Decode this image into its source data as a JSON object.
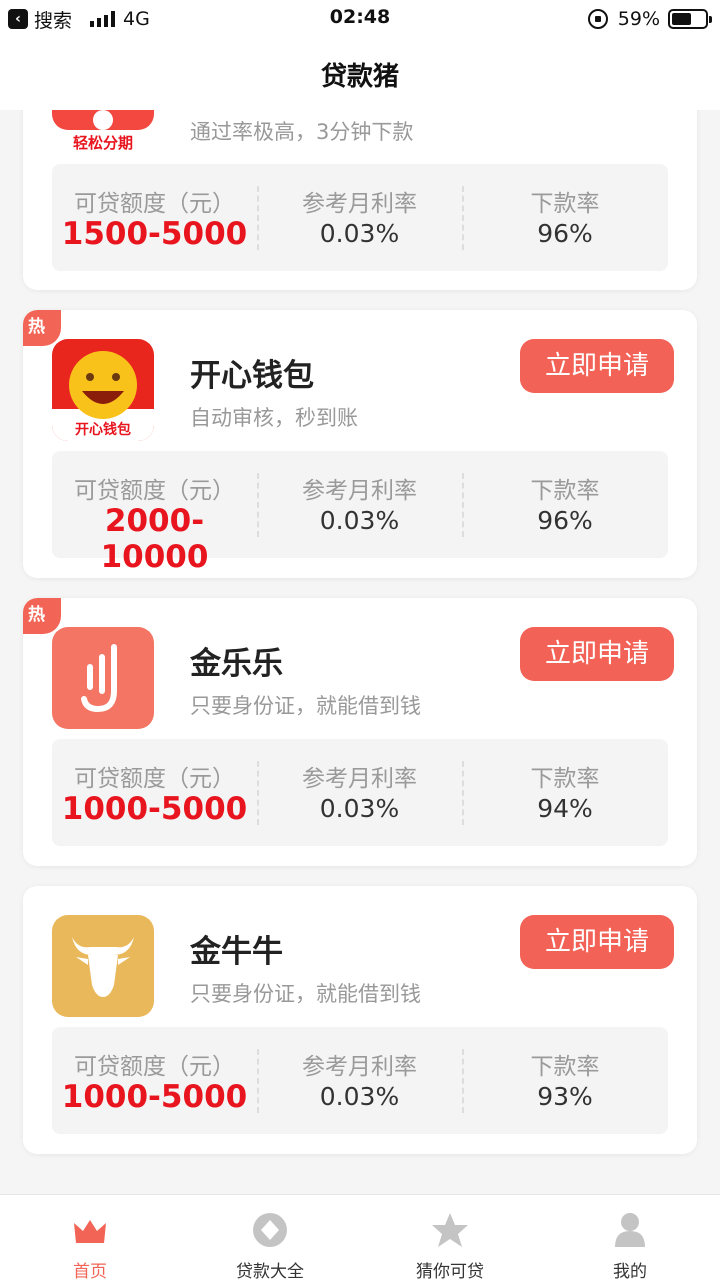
{
  "status_bar": {
    "back_app": "搜索",
    "network": "4G",
    "time": "02:48",
    "battery": "59%",
    "battery_level": 0.59
  },
  "nav": {
    "title": "贷款猪"
  },
  "common": {
    "amount_label": "可贷额度（元）",
    "rate_label": "参考月利率",
    "approval_label": "下款率",
    "apply_label": "立即申请",
    "hot_label": "热"
  },
  "products": [
    {
      "name": "轻松分期",
      "logo_text": "轻松分期",
      "description": "通过率极高，3分钟下款",
      "amount": "1500-5000",
      "rate": "0.03%",
      "approval": "96%",
      "hot": false
    },
    {
      "name": "开心钱包",
      "logo_text": "开心钱包",
      "description": "自动审核，秒到账",
      "amount": "2000-10000",
      "rate": "0.03%",
      "approval": "96%",
      "hot": true
    },
    {
      "name": "金乐乐",
      "description": "只要身份证，就能借到钱",
      "amount": "1000-5000",
      "rate": "0.03%",
      "approval": "94%",
      "hot": true
    },
    {
      "name": "金牛牛",
      "description": "只要身份证，就能借到钱",
      "amount": "1000-5000",
      "rate": "0.03%",
      "approval": "93%",
      "hot": false
    }
  ],
  "tabs": [
    {
      "label": "首页",
      "icon": "crown-icon",
      "active": true
    },
    {
      "label": "贷款大全",
      "icon": "coin-icon",
      "active": false
    },
    {
      "label": "猜你可贷",
      "icon": "star-icon",
      "active": false
    },
    {
      "label": "我的",
      "icon": "user-icon",
      "active": false
    }
  ],
  "colors": {
    "accent": "#f36256",
    "amount": "#e8141e",
    "tab_active": "#f26556"
  }
}
